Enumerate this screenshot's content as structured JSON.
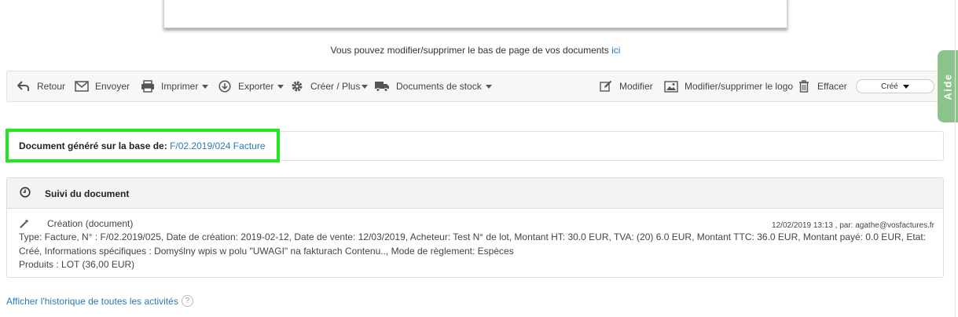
{
  "footer_note": {
    "text": "Vous pouvez modifier/supprimer le bas de page de vos documents",
    "link": "ici"
  },
  "toolbar": {
    "back": "Retour",
    "send": "Envoyer",
    "print": "Imprimer",
    "export": "Exporter",
    "create": "Créer / Plus",
    "stock_docs": "Documents de stock",
    "edit": "Modifier",
    "logo": "Modifier/supprimer le logo",
    "delete": "Effacer",
    "status": "Créé"
  },
  "help_tab": "Aide",
  "generated": {
    "label": "Document généré sur la base de:",
    "link": "F/02.2019/024 Facture"
  },
  "tracking": {
    "title": "Suivi du document",
    "event": "Création (document)",
    "meta": "12/02/2019 13:13 , par: agathe@vosfactures.fr",
    "details": "Type: Facture, N° : F/02.2019/025, Date de création: 2019-02-12, Date de vente: 12/03/2019, Acheteur: Test N° de lot, Montant HT: 30.0 EUR, TVA: (20) 6.0 EUR, Montant TTC: 36.0 EUR, Montant payé: 0.0 EUR, Etat: Créé, Informations spécifiques : Domyślny wpis w polu \"UWAGI\" na fakturach Contenu.., Mode de règlement: Espèces",
    "products": "Produits : LOT (36,00 EUR)"
  },
  "history_link": "Afficher l'historique de toutes les activités",
  "help_icon": "?",
  "colors": {
    "link": "#2a7ab8",
    "highlight": "#1ee81e",
    "help_tab": "#8bc38b"
  }
}
